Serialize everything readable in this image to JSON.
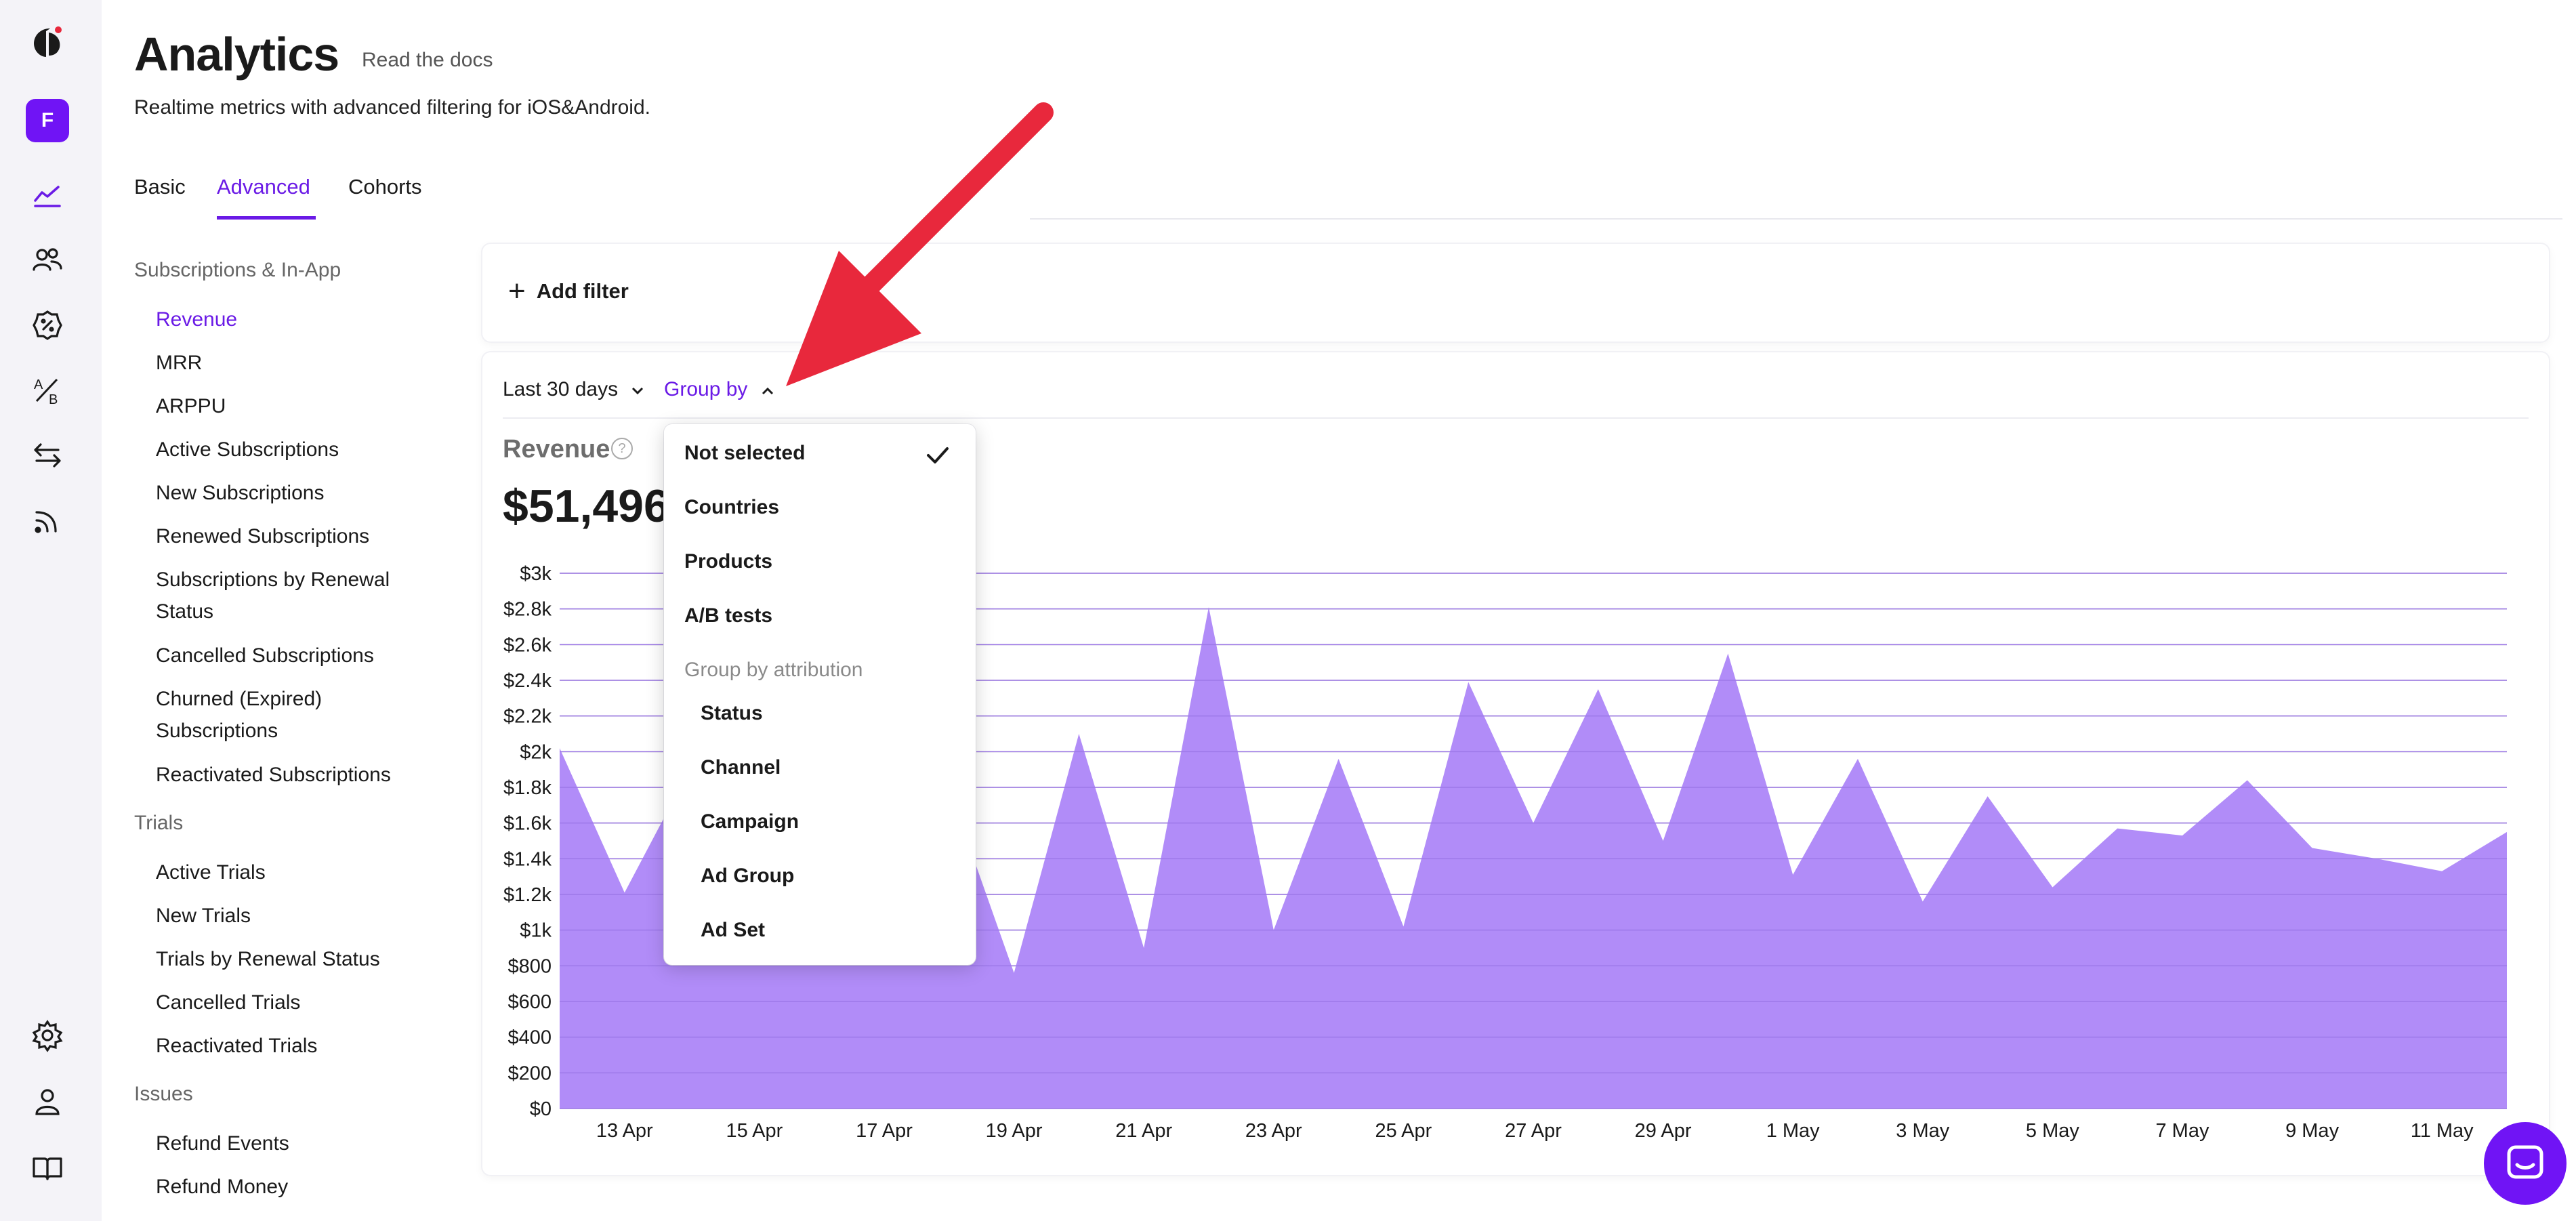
{
  "rail": {
    "workspace_initial": "F",
    "icons": [
      "logo-icon",
      "analytics-icon",
      "profiles-icon",
      "paywalls-icon",
      "ab-tests-icon",
      "transfers-icon",
      "events-feed-icon",
      "settings-icon",
      "account-icon",
      "docs-icon"
    ],
    "accent": "#7014f5"
  },
  "header": {
    "title": "Analytics",
    "docs_link": "Read the docs",
    "subtitle": "Realtime metrics with advanced filtering for iOS&Android."
  },
  "tabs": [
    {
      "label": "Basic",
      "active": false
    },
    {
      "label": "Advanced",
      "active": true
    },
    {
      "label": "Cohorts",
      "active": false
    }
  ],
  "sidebar": {
    "groups": [
      {
        "title": "Subscriptions & In-App",
        "items": [
          "Revenue",
          "MRR",
          "ARPPU",
          "Active Subscriptions",
          "New Subscriptions",
          "Renewed Subscriptions",
          "Subscriptions by Renewal Status",
          "Cancelled Subscriptions",
          "Churned (Expired) Subscriptions",
          "Reactivated Subscriptions"
        ]
      },
      {
        "title": "Trials",
        "items": [
          "Active Trials",
          "New Trials",
          "Trials by Renewal Status",
          "Cancelled Trials",
          "Reactivated Trials"
        ]
      },
      {
        "title": "Issues",
        "items": [
          "Refund Events",
          "Refund Money"
        ]
      }
    ],
    "active_item": "Revenue"
  },
  "filters": {
    "add_filter_label": "Add filter"
  },
  "chart_controls": {
    "period": "Last 30 days",
    "group_by": "Group by"
  },
  "metric": {
    "name": "Revenue",
    "help": "?",
    "value": "$51,496"
  },
  "dropdown": {
    "items": [
      "Not selected",
      "Countries",
      "Products",
      "A/B tests"
    ],
    "selected": "Not selected",
    "attribution_header": "Group by attribution",
    "attribution_items": [
      "Status",
      "Channel",
      "Campaign",
      "Ad Group",
      "Ad Set"
    ]
  },
  "chart_data": {
    "type": "area",
    "title": "Revenue",
    "xlabel": "",
    "ylabel": "",
    "ylim": [
      0,
      3000
    ],
    "grid": true,
    "color": "#b18cf8",
    "y_ticks": [
      "$0",
      "$200",
      "$400",
      "$600",
      "$800",
      "$1k",
      "$1.2k",
      "$1.4k",
      "$1.6k",
      "$1.8k",
      "$2k",
      "$2.2k",
      "$2.4k",
      "$2.6k",
      "$2.8k",
      "$3k"
    ],
    "x_ticks": [
      "13 Apr",
      "15 Apr",
      "17 Apr",
      "19 Apr",
      "21 Apr",
      "23 Apr",
      "25 Apr",
      "27 Apr",
      "29 Apr",
      "1 May",
      "3 May",
      "5 May",
      "7 May",
      "9 May",
      "11 May"
    ],
    "x": [
      "12 Apr",
      "13 Apr",
      "14 Apr",
      "15 Apr",
      "16 Apr",
      "17 Apr",
      "18 Apr",
      "19 Apr",
      "20 Apr",
      "21 Apr",
      "22 Apr",
      "23 Apr",
      "24 Apr",
      "25 Apr",
      "26 Apr",
      "27 Apr",
      "28 Apr",
      "29 Apr",
      "30 Apr",
      "1 May",
      "2 May",
      "3 May",
      "4 May",
      "5 May",
      "6 May",
      "7 May",
      "8 May",
      "9 May",
      "10 May",
      "11 May",
      "12 May"
    ],
    "values": [
      2020,
      1210,
      1900,
      1700,
      1500,
      1500,
      1790,
      760,
      2100,
      900,
      2810,
      1000,
      1960,
      1020,
      2390,
      1600,
      2350,
      1500,
      2550,
      1310,
      1960,
      1160,
      1750,
      1240,
      1570,
      1530,
      1840,
      1460,
      1400,
      1330,
      1550
    ]
  }
}
